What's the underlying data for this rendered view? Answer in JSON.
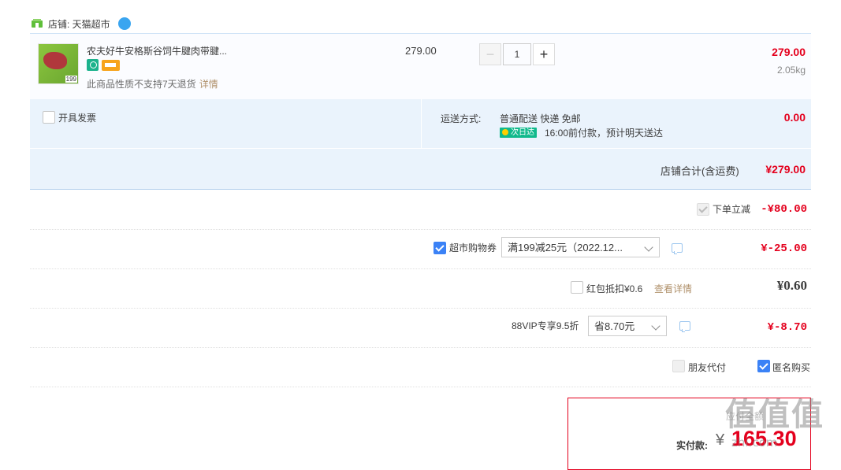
{
  "shop": {
    "label": "店铺: 天猫超市"
  },
  "item": {
    "title": "农夫好牛安格斯谷饲牛腱肉带腱...",
    "thumb_price": "199",
    "note": "此商品性质不支持7天退货",
    "note_link": "详情",
    "unit_price": "279.00",
    "quantity": "1",
    "minus": "−",
    "plus": "+",
    "total": "279.00",
    "weight": "2.05kg"
  },
  "options": {
    "invoice_label": "开具发票",
    "shipping_label": "运送方式:",
    "shipping_value": "普通配送 快递 免邮",
    "nextday_badge": "次日达",
    "shipping_eta": "16:00前付款，预计明天送达",
    "shipping_fee": "0.00",
    "store_total_label": "店铺合计(含运费)",
    "store_total_value": "¥279.00"
  },
  "discounts": {
    "instant": {
      "label": "下单立减",
      "value": "-¥80.00"
    },
    "coupon": {
      "label": "超市购物券",
      "selected": "满199减25元（2022.12...",
      "value": "¥-25.00"
    },
    "redpacket": {
      "label": "红包抵扣¥0.6",
      "link": "查看详情",
      "value": "¥0.60"
    },
    "vip": {
      "label": "88VIP专享9.5折",
      "selected": "省8.70元",
      "value": "¥-8.70"
    }
  },
  "extras": {
    "friend_pay": "朋友代付",
    "anonymous": "匿名购买"
  },
  "payment": {
    "faint_text": "应付全额",
    "label": "实付款:",
    "currency": "¥",
    "amount": "165.30"
  },
  "watermark": {
    "main": "值值值",
    "sub": "zhi.com"
  },
  "colors": {
    "accent_red": "#e4001d",
    "check_blue": "#3b82f6",
    "band_bg": "#eaf3fc",
    "link_brown": "#b0916b"
  }
}
